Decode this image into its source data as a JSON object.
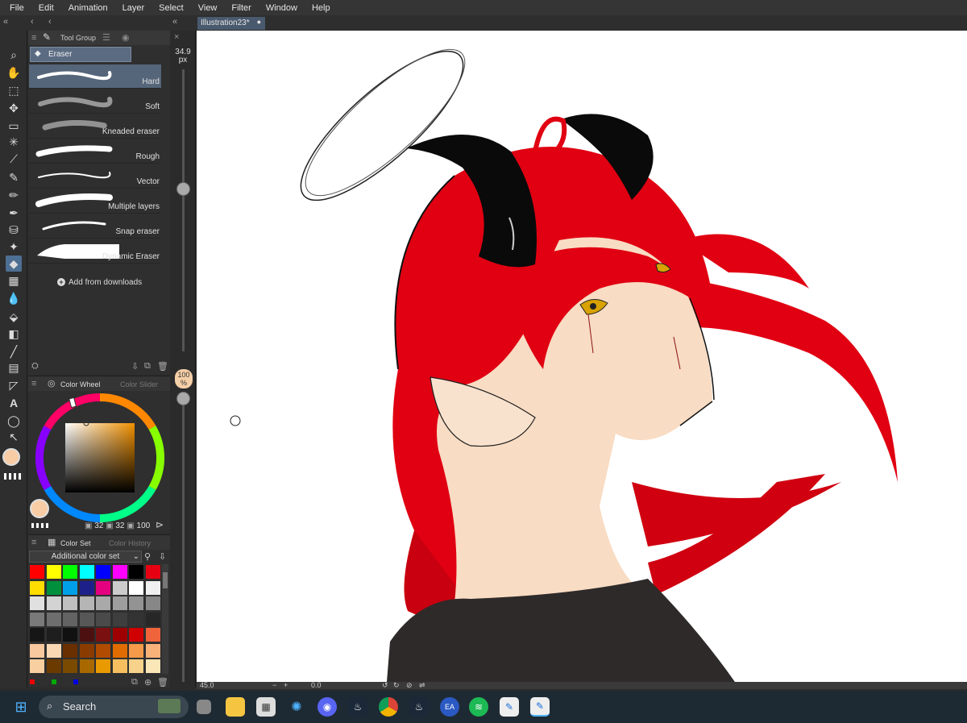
{
  "menu": [
    "File",
    "Edit",
    "Animation",
    "Layer",
    "Select",
    "View",
    "Filter",
    "Window",
    "Help"
  ],
  "canvas_tab": "Illustration23*",
  "subtool": {
    "panel_label": "Tool Group",
    "group": "Eraser",
    "brushes": [
      "Hard",
      "Soft",
      "Kneaded eraser",
      "Rough",
      "Vector",
      "Multiple layers",
      "Snap eraser",
      "Dynamic Eraser"
    ],
    "selected": "Hard",
    "add_downloads": "Add from downloads"
  },
  "brush_size": {
    "value": "34.9",
    "unit": "px"
  },
  "opacity": {
    "value": "100",
    "unit": "%"
  },
  "color_wheel": {
    "tab1": "Color Wheel",
    "tab2": "Color Slider",
    "values": [
      "32",
      "32",
      "100"
    ],
    "main_color": "#f8cda6"
  },
  "color_set": {
    "tab1": "Color Set",
    "tab2": "Color History",
    "select": "Additional color set",
    "rows": [
      [
        "#ff0000",
        "#ffff00",
        "#00ff00",
        "#00ffff",
        "#0000ff",
        "#ff00ff",
        "#000000",
        "#e60012"
      ],
      [
        "#ffdd00",
        "#008f3c",
        "#00a0e9",
        "#1d2088",
        "#e4007f",
        "#cccccc",
        "#ffffff",
        "#f0f0f0"
      ],
      [
        "#e0e0e0",
        "#d3d3d3",
        "#c0c0c0",
        "#b5b5b5",
        "#a9a9a9",
        "#9e9e9e",
        "#939393",
        "#878787"
      ],
      [
        "#7a7a7a",
        "#6e6e6e",
        "#636363",
        "#575757",
        "#4a4a4a",
        "#3e3e3e",
        "#333333",
        "#272727"
      ],
      [
        "#161616",
        "#1e1e1e",
        "#111111",
        "#4d1010",
        "#7a1010",
        "#9e0000",
        "#d00000",
        "#f0643c"
      ],
      [
        "#f8c89e",
        "#fbd8b4",
        "#6a2f00",
        "#8a3c00",
        "#b04b00",
        "#e06c00",
        "#f49a4a",
        "#f7b27a"
      ],
      [
        "#f8cfa0",
        "#6b3a00",
        "#7a4a00",
        "#a86a00",
        "#e89a00",
        "#f5bf60",
        "#f7d28a",
        "#fbe6b8"
      ]
    ]
  },
  "status": {
    "zoom": "45.0",
    "angle": "0.0"
  },
  "taskbar": {
    "search": "Search"
  }
}
